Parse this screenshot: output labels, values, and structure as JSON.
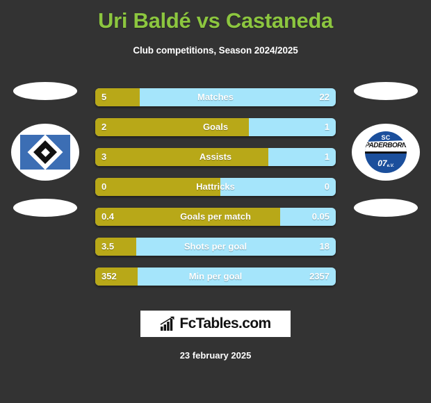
{
  "header": {
    "title": "Uri Baldé vs Castaneda",
    "subtitle": "Club competitions, Season 2024/2025",
    "title_color": "#8cc63f"
  },
  "teams": {
    "home": {
      "name": "Hamburger SV",
      "crest_icon": "hsv-crest-icon",
      "colors": {
        "field": "#3c6eb4",
        "diamond": "#ffffff",
        "center": "#111111"
      }
    },
    "away": {
      "name": "SC Paderborn 07",
      "crest_icon": "paderborn-crest-icon",
      "line1": "SC",
      "line2": "PADERBORN",
      "line3": "07",
      "line3_suffix": "e.V.",
      "colors": {
        "field": "#1b4f9c",
        "band": "#ffffff",
        "text": "#111111"
      }
    }
  },
  "colors": {
    "background": "#333333",
    "home_bar": "#b8a818",
    "away_bar": "#a5e5fb",
    "text": "#ffffff"
  },
  "chart_data": {
    "type": "bar",
    "title": "Uri Baldé vs Castaneda",
    "subtitle": "Club competitions, Season 2024/2025",
    "orientation": "horizontal-diverging",
    "series": [
      {
        "name": "Uri Baldé",
        "color": "#b8a818",
        "align": "left"
      },
      {
        "name": "Castaneda",
        "color": "#a5e5fb",
        "align": "right"
      }
    ],
    "categories": [
      "Matches",
      "Goals",
      "Assists",
      "Hattricks",
      "Goals per match",
      "Shots per goal",
      "Min per goal"
    ],
    "home_values": [
      "5",
      "2",
      "3",
      "0",
      "0.4",
      "3.5",
      "352"
    ],
    "away_values": [
      "22",
      "1",
      "1",
      "0",
      "0.05",
      "18",
      "2357"
    ],
    "home_share_pct": [
      18.5,
      64,
      72,
      52,
      77,
      17,
      17.7
    ]
  },
  "stats": [
    {
      "label": "Matches",
      "home": "5",
      "away": "22",
      "home_pct": 18.5
    },
    {
      "label": "Goals",
      "home": "2",
      "away": "1",
      "home_pct": 64
    },
    {
      "label": "Assists",
      "home": "3",
      "away": "1",
      "home_pct": 72
    },
    {
      "label": "Hattricks",
      "home": "0",
      "away": "0",
      "home_pct": 52
    },
    {
      "label": "Goals per match",
      "home": "0.4",
      "away": "0.05",
      "home_pct": 77
    },
    {
      "label": "Shots per goal",
      "home": "3.5",
      "away": "18",
      "home_pct": 17
    },
    {
      "label": "Min per goal",
      "home": "352",
      "away": "2357",
      "home_pct": 17.7
    }
  ],
  "footer": {
    "brand": "FcTables.com",
    "brand_icon": "bar-chart-growth-icon",
    "date": "23 february 2025"
  }
}
